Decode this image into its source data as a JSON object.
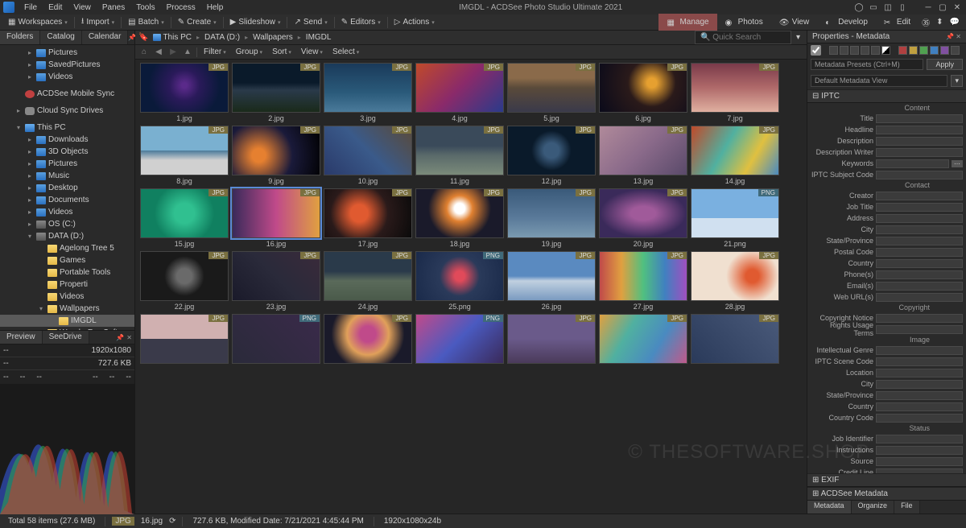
{
  "window_title": "IMGDL - ACDSee Photo Studio Ultimate 2021",
  "menu": [
    "File",
    "Edit",
    "View",
    "Panes",
    "Tools",
    "Process",
    "Help"
  ],
  "toolbar": {
    "workspaces": "Workspaces",
    "import": "Import",
    "batch": "Batch",
    "create": "Create",
    "slideshow": "Slideshow",
    "send": "Send",
    "editors": "Editors",
    "actions": "Actions"
  },
  "modes": {
    "manage": "Manage",
    "photos": "Photos",
    "view": "View",
    "develop": "Develop",
    "edit": "Edit"
  },
  "left_tabs": {
    "folders": "Folders",
    "catalog": "Catalog",
    "calendar": "Calendar"
  },
  "tree": {
    "pictures": "Pictures",
    "savedpictures": "SavedPictures",
    "videos": "Videos",
    "mobilesync": "ACDSee Mobile Sync",
    "cloud": "Cloud Sync Drives",
    "thispc": "This PC",
    "downloads": "Downloads",
    "objects3d": "3D Objects",
    "pictures2": "Pictures",
    "music": "Music",
    "desktop": "Desktop",
    "documents": "Documents",
    "videos2": "Videos",
    "osc": "OS (C:)",
    "datad": "DATA (D:)",
    "agelong": "Agelong Tree 5",
    "games": "Games",
    "portable": "Portable Tools",
    "properti": "Properti",
    "videos3": "Videos",
    "wallpapers": "Wallpapers",
    "imgdl": "IMGDL",
    "wonderfox": "WonderFox Soft"
  },
  "preview_tabs": {
    "preview": "Preview",
    "seedrive": "SeeDrive"
  },
  "preview": {
    "dash": "--",
    "resolution": "1920x1080",
    "size": "727.6 KB"
  },
  "breadcrumb": {
    "thispc": "This PC",
    "datad": "DATA (D:)",
    "wallpapers": "Wallpapers",
    "imgdl": "IMGDL"
  },
  "search_placeholder": "Quick Search",
  "filters": {
    "filter": "Filter",
    "group": "Group",
    "sort": "Sort",
    "view": "View",
    "select": "Select"
  },
  "thumbs": [
    [
      "1.jpg",
      "JPG",
      "g1"
    ],
    [
      "2.jpg",
      "JPG",
      "g2"
    ],
    [
      "3.jpg",
      "JPG",
      "g3"
    ],
    [
      "4.jpg",
      "JPG",
      "g4"
    ],
    [
      "5.jpg",
      "JPG",
      "g5"
    ],
    [
      "6.jpg",
      "JPG",
      "g6"
    ],
    [
      "7.jpg",
      "JPG",
      "g7"
    ],
    [
      "8.jpg",
      "JPG",
      "g8"
    ],
    [
      "9.jpg",
      "JPG",
      "g9"
    ],
    [
      "10.jpg",
      "JPG",
      "g10"
    ],
    [
      "11.jpg",
      "JPG",
      "g11"
    ],
    [
      "12.jpg",
      "JPG",
      "g12"
    ],
    [
      "13.jpg",
      "JPG",
      "g13"
    ],
    [
      "14.jpg",
      "JPG",
      "g14"
    ],
    [
      "15.jpg",
      "JPG",
      "g15"
    ],
    [
      "16.jpg",
      "JPG",
      "g16"
    ],
    [
      "17.jpg",
      "JPG",
      "g17"
    ],
    [
      "18.jpg",
      "JPG",
      "g18"
    ],
    [
      "19.jpg",
      "JPG",
      "g19"
    ],
    [
      "20.jpg",
      "JPG",
      "g20"
    ],
    [
      "21.png",
      "PNG",
      "g21"
    ],
    [
      "22.jpg",
      "JPG",
      "g22"
    ],
    [
      "23.jpg",
      "JPG",
      "g23"
    ],
    [
      "24.jpg",
      "JPG",
      "g24"
    ],
    [
      "25.png",
      "PNG",
      "g25"
    ],
    [
      "26.jpg",
      "JPG",
      "g26"
    ],
    [
      "27.jpg",
      "JPG",
      "g27"
    ],
    [
      "28.jpg",
      "JPG",
      "g28"
    ],
    [
      "",
      "JPG",
      "g29"
    ],
    [
      "",
      "PNG",
      "g30"
    ],
    [
      "",
      "JPG",
      "g31"
    ],
    [
      "",
      "PNG",
      "g32"
    ],
    [
      "",
      "JPG",
      "g33"
    ],
    [
      "",
      "JPG",
      "g34"
    ],
    [
      "",
      "JPG",
      "g35"
    ]
  ],
  "selected_thumb_index": 15,
  "props": {
    "title": "Properties - Metadata",
    "preset_ph": "Metadata Presets (Ctrl+M)",
    "apply": "Apply",
    "default_view": "Default Metadata View",
    "iptc": "IPTC",
    "groups": {
      "content": "Content",
      "contact": "Contact",
      "copyright": "Copyright",
      "image": "Image",
      "status": "Status"
    },
    "fields": {
      "title": "Title",
      "headline": "Headline",
      "description": "Description",
      "dwriter": "Description Writer",
      "keywords": "Keywords",
      "subjcode": "IPTC Subject Code",
      "creator": "Creator",
      "jobtitle": "Job Title",
      "address": "Address",
      "city": "City",
      "state": "State/Province",
      "postal": "Postal Code",
      "country": "Country",
      "phones": "Phone(s)",
      "emails": "Email(s)",
      "weburls": "Web URL(s)",
      "cnotice": "Copyright Notice",
      "rights": "Rights Usage Terms",
      "igenre": "Intellectual Genre",
      "scenecode": "IPTC Scene Code",
      "location": "Location",
      "city2": "City",
      "state2": "State/Province",
      "country2": "Country",
      "ccode": "Country Code",
      "jobid": "Job Identifier",
      "instr": "Instructions",
      "source": "Source",
      "credit": "Credit Line"
    },
    "exif": "EXIF",
    "acdmeta": "ACDSee Metadata",
    "btabs": {
      "metadata": "Metadata",
      "organize": "Organize",
      "file": "File"
    }
  },
  "status": {
    "total": "Total 58 items   (27.6 MB)",
    "badge": "JPG",
    "fname": "16.jpg",
    "fsize": "727.6 KB, Modified Date: 7/21/2021 4:45:44 PM",
    "dims": "1920x1080x24b"
  },
  "watermark": "© THESOFTWARE.SHOP"
}
